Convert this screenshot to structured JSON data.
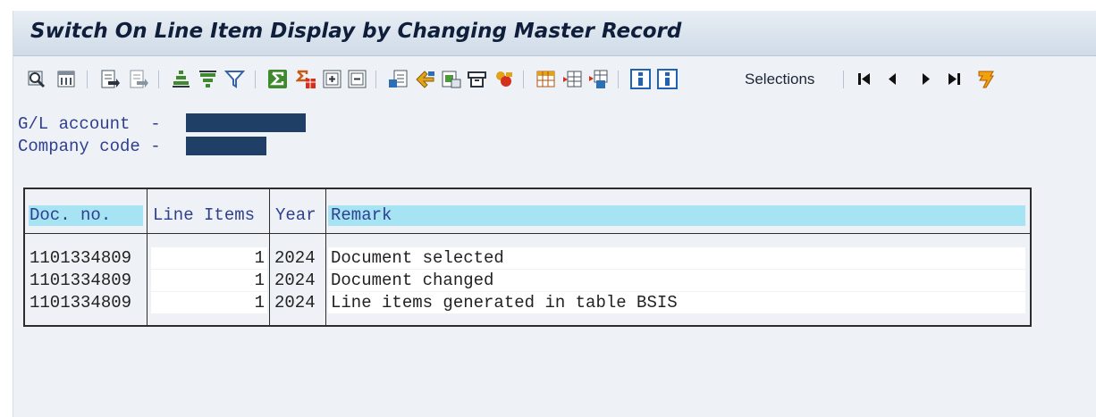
{
  "window": {
    "title": "Switch On Line Item Display by Changing Master Record"
  },
  "toolbar": {
    "selections_label": "Selections",
    "icons": [
      "detail-icon",
      "print-preview-icon",
      "export-icon",
      "export-alt-icon",
      "sort-ascending-icon",
      "sort-descending-icon",
      "filter-icon",
      "total-icon",
      "subtotal-icon",
      "expand-icon",
      "collapse-icon",
      "spreadsheet-icon",
      "word-processing-icon",
      "local-file-icon",
      "mail-icon",
      "abc-analysis-icon",
      "layout-icon",
      "select-layout-icon",
      "save-layout-icon",
      "info-icon",
      "selections-icon",
      "first-page-icon",
      "previous-page-icon",
      "next-page-icon",
      "last-page-icon",
      "exit-icon"
    ]
  },
  "header": {
    "gl_account_label": "G/L account  -",
    "company_code_label": "Company code -"
  },
  "table": {
    "columns": [
      "Doc. no.",
      "Line Items",
      "Year",
      "Remark"
    ],
    "rows": [
      {
        "doc_no": "1101334809",
        "line_items": "1",
        "year": "2024",
        "remark": "Document selected"
      },
      {
        "doc_no": "1101334809",
        "line_items": "1",
        "year": "2024",
        "remark": "Document changed"
      },
      {
        "doc_no": "1101334809",
        "line_items": "1",
        "year": "2024",
        "remark": "Line items generated in table BSIS"
      }
    ]
  },
  "colors": {
    "header_highlight": "#a6e4f4",
    "redaction": "#1f3f66",
    "label_text": "#2f3e8f"
  }
}
